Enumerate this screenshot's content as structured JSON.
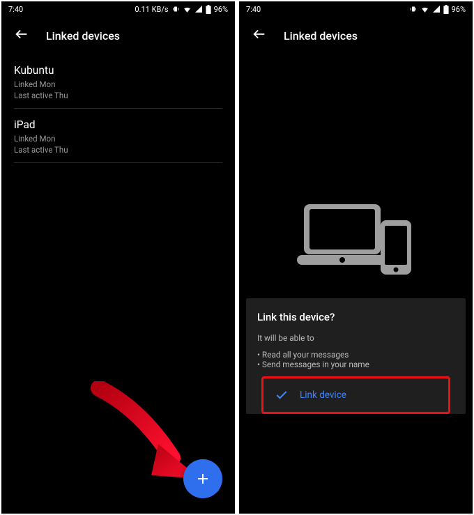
{
  "status": {
    "time": "7:40",
    "net": "0.11 KB/s",
    "battery": "96%"
  },
  "left": {
    "title": "Linked devices",
    "devices": [
      {
        "name": "Kubuntu",
        "linked": "Linked Mon",
        "active": "Last active Thu"
      },
      {
        "name": "iPad",
        "linked": "Linked Mon",
        "active": "Last active Thu"
      }
    ]
  },
  "right": {
    "title": "Linked devices",
    "card_title": "Link this device?",
    "intro": "It will be able to",
    "bullets": [
      "Read all your messages",
      "Send messages in your name"
    ],
    "link_label": "Link device"
  }
}
